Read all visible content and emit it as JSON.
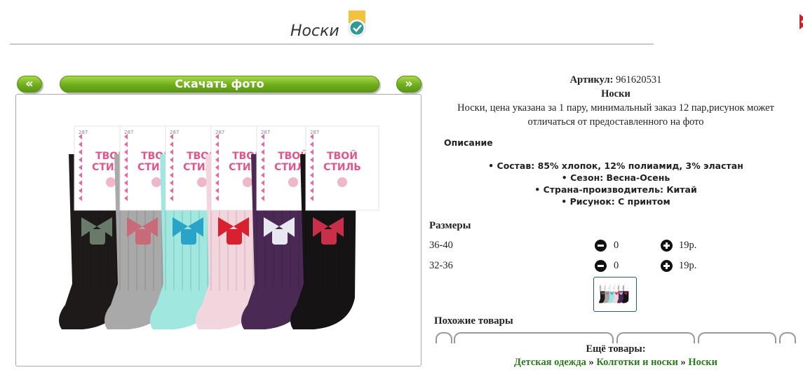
{
  "header": {
    "title": "Носки"
  },
  "toolbar": {
    "prev_label": "«",
    "download_label": "Скачать фото",
    "next_label": "»"
  },
  "product": {
    "article_label": "Артикул:",
    "article_value": "961620531",
    "name": "Носки",
    "note_line1": "Носки, цена указана за 1 пару, минимальный заказ 12 пар,рисунок может",
    "note_line2": "отличаться от предоставленного на фото"
  },
  "description": {
    "title": "Описание",
    "items": [
      "Состав: 85% хлопок, 12% полиамид, 3% эластан",
      "Сезон: Весна-Осень",
      "Страна-производитель: Китай",
      "Рисунок: С принтом"
    ]
  },
  "sizes": {
    "title": "Размеры",
    "rows": [
      {
        "size": "36-40",
        "qty": "0",
        "price": "19р."
      },
      {
        "size": "32-36",
        "qty": "0",
        "price": "19р."
      }
    ]
  },
  "similar": {
    "title": "Похожие товары"
  },
  "more": {
    "title": "Ещё товары:",
    "links": [
      "Детская одежда",
      "Колготки и носки",
      "Носки"
    ],
    "separator": "»"
  },
  "photo": {
    "brand_line1": "ТВОЙ",
    "brand_line2": "СТИЛЬ",
    "sock_colors": [
      "#1e1a1a",
      "#a9a9a9",
      "#9fe7df",
      "#f3d5de",
      "#4a2a55",
      "#151313"
    ],
    "tag_number": "287"
  },
  "colors": {
    "accent_green": "#6fae1c",
    "link_green": "#2b7a1e"
  }
}
